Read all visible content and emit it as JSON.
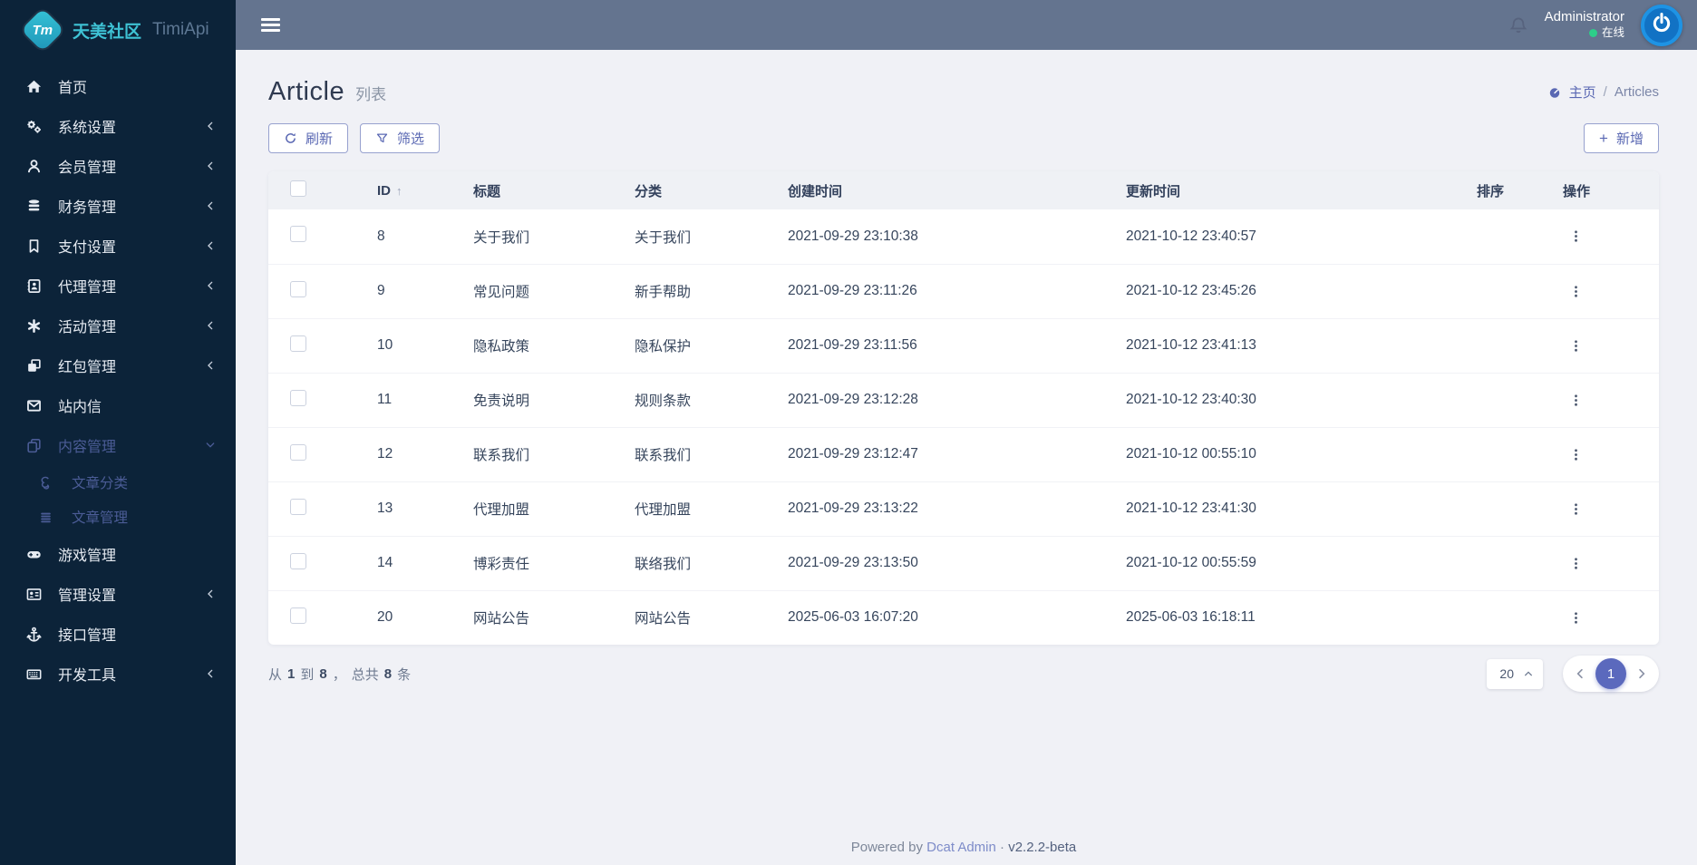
{
  "brand": {
    "logo_initials": "Tm",
    "name_cn": "天美社区",
    "name_en": "TimiApi"
  },
  "header": {
    "user_name": "Administrator",
    "status_label": "在线"
  },
  "sidebar": {
    "items": [
      {
        "name": "home",
        "label": "首页",
        "icon": "home-icon",
        "chevron": "none",
        "active": false
      },
      {
        "name": "system-settings",
        "label": "系统设置",
        "icon": "gears-icon",
        "chevron": "collapsed",
        "active": false
      },
      {
        "name": "member-management",
        "label": "会员管理",
        "icon": "user-icon",
        "chevron": "collapsed",
        "active": false
      },
      {
        "name": "finance-management",
        "label": "财务管理",
        "icon": "database-icon",
        "chevron": "collapsed",
        "active": false
      },
      {
        "name": "payment-settings",
        "label": "支付设置",
        "icon": "bookmark-icon",
        "chevron": "collapsed",
        "active": false
      },
      {
        "name": "agent-management",
        "label": "代理管理",
        "icon": "address-book-icon",
        "chevron": "collapsed",
        "active": false
      },
      {
        "name": "activity-management",
        "label": "活动管理",
        "icon": "asterisk-icon",
        "chevron": "collapsed",
        "active": false
      },
      {
        "name": "red-packet-management",
        "label": "红包管理",
        "icon": "red-packet-icon",
        "chevron": "collapsed",
        "active": false
      },
      {
        "name": "site-messages",
        "label": "站内信",
        "icon": "envelope-icon",
        "chevron": "none",
        "active": false
      },
      {
        "name": "content-management",
        "label": "内容管理",
        "icon": "copy-icon",
        "chevron": "expanded",
        "active": true,
        "children": [
          {
            "name": "article-category",
            "label": "文章分类",
            "icon": "spiral-icon",
            "active": true
          },
          {
            "name": "article-management",
            "label": "文章管理",
            "icon": "list-icon",
            "active": true
          }
        ]
      },
      {
        "name": "game-management",
        "label": "游戏管理",
        "icon": "gamepad-icon",
        "chevron": "none",
        "active": false
      },
      {
        "name": "admin-settings",
        "label": "管理设置",
        "icon": "id-card-icon",
        "chevron": "collapsed",
        "active": false
      },
      {
        "name": "api-management",
        "label": "接口管理",
        "icon": "anchor-icon",
        "chevron": "none",
        "active": false
      },
      {
        "name": "dev-tools",
        "label": "开发工具",
        "icon": "keyboard-icon",
        "chevron": "collapsed",
        "active": false
      }
    ]
  },
  "page": {
    "title": "Article",
    "subtitle": "列表",
    "breadcrumb": {
      "home": "主页",
      "separator": "/",
      "current": "Articles"
    }
  },
  "toolbar": {
    "refresh_label": "刷新",
    "filter_label": "筛选",
    "add_label": "新增",
    "add_plus": "+"
  },
  "table": {
    "columns": [
      "ID",
      "标题",
      "分类",
      "创建时间",
      "更新时间",
      "排序",
      "操作"
    ],
    "sort_column": "ID",
    "sort_direction_glyph": "↑",
    "rows": [
      {
        "id": "8",
        "title": "关于我们",
        "category": "关于我们",
        "created_at": "2021-09-29 23:10:38",
        "updated_at": "2021-10-12 23:40:57"
      },
      {
        "id": "9",
        "title": "常见问题",
        "category": "新手帮助",
        "created_at": "2021-09-29 23:11:26",
        "updated_at": "2021-10-12 23:45:26"
      },
      {
        "id": "10",
        "title": "隐私政策",
        "category": "隐私保护",
        "created_at": "2021-09-29 23:11:56",
        "updated_at": "2021-10-12 23:41:13"
      },
      {
        "id": "11",
        "title": "免责说明",
        "category": "规则条款",
        "created_at": "2021-09-29 23:12:28",
        "updated_at": "2021-10-12 23:40:30"
      },
      {
        "id": "12",
        "title": "联系我们",
        "category": "联系我们",
        "created_at": "2021-09-29 23:12:47",
        "updated_at": "2021-10-12 00:55:10"
      },
      {
        "id": "13",
        "title": "代理加盟",
        "category": "代理加盟",
        "created_at": "2021-09-29 23:13:22",
        "updated_at": "2021-10-12 23:41:30"
      },
      {
        "id": "14",
        "title": "博彩责任",
        "category": "联络我们",
        "created_at": "2021-09-29 23:13:50",
        "updated_at": "2021-10-12 00:55:59"
      },
      {
        "id": "20",
        "title": "网站公告",
        "category": "网站公告",
        "created_at": "2025-06-03 16:07:20",
        "updated_at": "2025-06-03 16:18:11"
      }
    ]
  },
  "pagination": {
    "summary": {
      "prefix": "从",
      "from": "1",
      "to_label": "到",
      "to": "8",
      "comma": "，",
      "total_label": "总共",
      "total": "8",
      "unit": "条"
    },
    "per_page": "20",
    "current_page": "1"
  },
  "footer": {
    "powered_by": "Powered by",
    "brand_link": "Dcat Admin",
    "separator": "·",
    "version": "v2.2.2-beta"
  },
  "colors": {
    "sidebar_bg": "#0c2339",
    "header_bg": "#64748f",
    "page_bg": "#f0f1f6",
    "accent": "#5a68b3",
    "active_page_bg": "#5b69bd",
    "menu_active": "#4b5c96",
    "avatar_blue": "#1272c4",
    "online_green": "#2dce89",
    "brand_teal": "#3ec2d4"
  }
}
